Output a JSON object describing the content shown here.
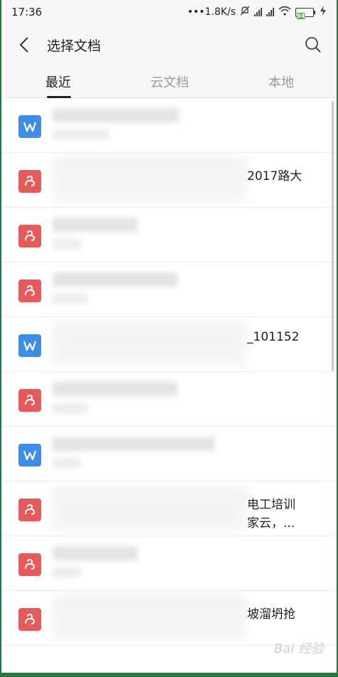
{
  "status_bar": {
    "time": "17:36",
    "network_speed": "•••1.8K/s",
    "battery_level": "94"
  },
  "header": {
    "title": "选择文档"
  },
  "tabs": [
    {
      "label": "最近",
      "active": true
    },
    {
      "label": "云文档",
      "active": false
    },
    {
      "label": "本地",
      "active": false
    }
  ],
  "files": [
    {
      "type": "word",
      "visible_name": "",
      "visible_name_2": ""
    },
    {
      "type": "pdf",
      "visible_name": "2017路大",
      "visible_name_2": ""
    },
    {
      "type": "pdf",
      "visible_name": "",
      "visible_name_2": ""
    },
    {
      "type": "pdf",
      "visible_name": "",
      "visible_name_2": ""
    },
    {
      "type": "word",
      "visible_name": "_101152",
      "visible_name_2": ""
    },
    {
      "type": "pdf",
      "visible_name": "",
      "visible_name_2": ""
    },
    {
      "type": "word",
      "visible_name": "",
      "visible_name_2": ""
    },
    {
      "type": "pdf",
      "visible_name": "电工培训",
      "visible_name_2": "家云，..."
    },
    {
      "type": "pdf",
      "visible_name": "",
      "visible_name_2": ""
    },
    {
      "type": "pdf",
      "visible_name": "坡溜坍抢",
      "visible_name_2": ""
    }
  ],
  "watermark": "Bai 经验",
  "colors": {
    "word_icon": "#3d8ee8",
    "pdf_icon": "#e85a5a",
    "frame": "#1f7a3c"
  }
}
